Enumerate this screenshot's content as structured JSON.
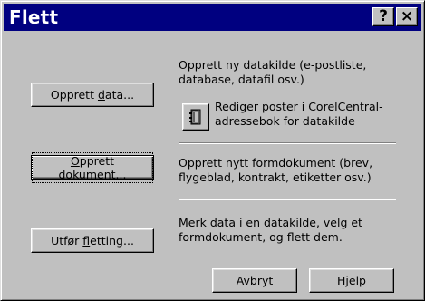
{
  "window": {
    "title": "Flett",
    "help_button": "?",
    "close_button": "×"
  },
  "create_data": {
    "label_pre": "Opprett ",
    "label_access": "d",
    "label_post": "ata...",
    "description": "Opprett ny datakilde (e-postliste, database, datafil osv.)"
  },
  "edit_records": {
    "icon": "address-book-icon",
    "description": "Rediger poster i CorelCentral-adressebok for datakilde"
  },
  "create_document": {
    "label_pre": "",
    "label_access": "O",
    "label_post": "pprett dokument...",
    "description": "Opprett nytt formdokument (brev, flygeblad, kontrakt, etiketter osv.)"
  },
  "perform_merge": {
    "label_pre": "Utfør ",
    "label_access": "f",
    "label_post": "letting...",
    "description": "Merk data i en datakilde, velg et formdokument, og flett dem."
  },
  "footer": {
    "cancel_label": "Avbryt",
    "help_pre": "",
    "help_access": "H",
    "help_post": "jelp"
  }
}
